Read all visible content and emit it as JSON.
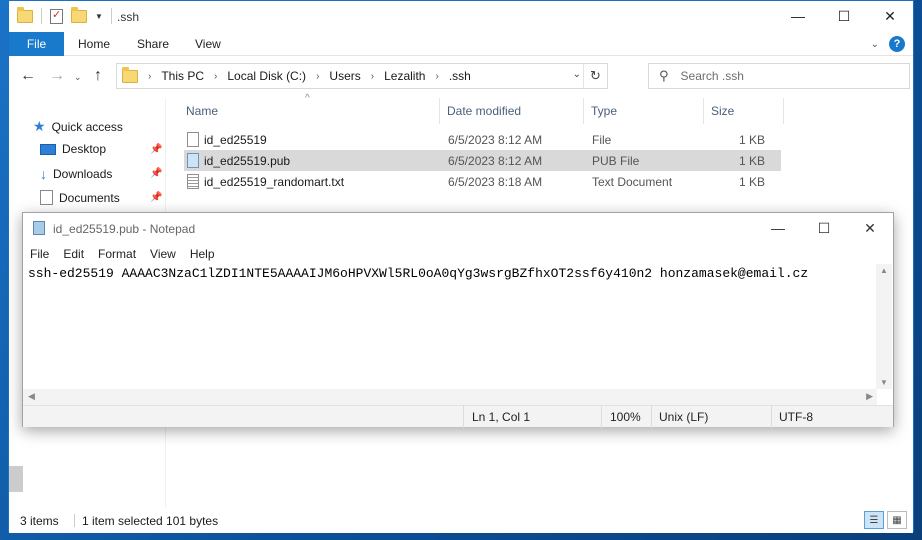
{
  "explorer": {
    "title": ".ssh",
    "ribbon_tabs": [
      "File",
      "Home",
      "Share",
      "View"
    ],
    "address": [
      "This PC",
      "Local Disk (C:)",
      "Users",
      "Lezalith",
      ".ssh"
    ],
    "search_placeholder": "Search .ssh",
    "sidebar": {
      "quick_access": "Quick access",
      "items": [
        "Desktop",
        "Downloads",
        "Documents"
      ]
    },
    "columns": {
      "name": "Name",
      "date": "Date modified",
      "type": "Type",
      "size": "Size"
    },
    "files": [
      {
        "name": "id_ed25519",
        "date": "6/5/2023 8:12 AM",
        "type": "File",
        "size": "1 KB"
      },
      {
        "name": "id_ed25519.pub",
        "date": "6/5/2023 8:12 AM",
        "type": "PUB File",
        "size": "1 KB"
      },
      {
        "name": "id_ed25519_randomart.txt",
        "date": "6/5/2023 8:18 AM",
        "type": "Text Document",
        "size": "1 KB"
      }
    ],
    "status": {
      "items": "3 items",
      "selected": "1 item selected  101 bytes"
    }
  },
  "notepad": {
    "title": "id_ed25519.pub - Notepad",
    "menu": [
      "File",
      "Edit",
      "Format",
      "View",
      "Help"
    ],
    "content": "ssh-ed25519 AAAAC3NzaC1lZDI1NTE5AAAAIJM6oHPVXWl5RL0oA0qYg3wsrgBZfhxOT2ssf6y410n2 honzamasek@email.cz",
    "status": {
      "position": "Ln 1, Col 1",
      "zoom": "100%",
      "eol": "Unix (LF)",
      "encoding": "UTF-8"
    }
  }
}
